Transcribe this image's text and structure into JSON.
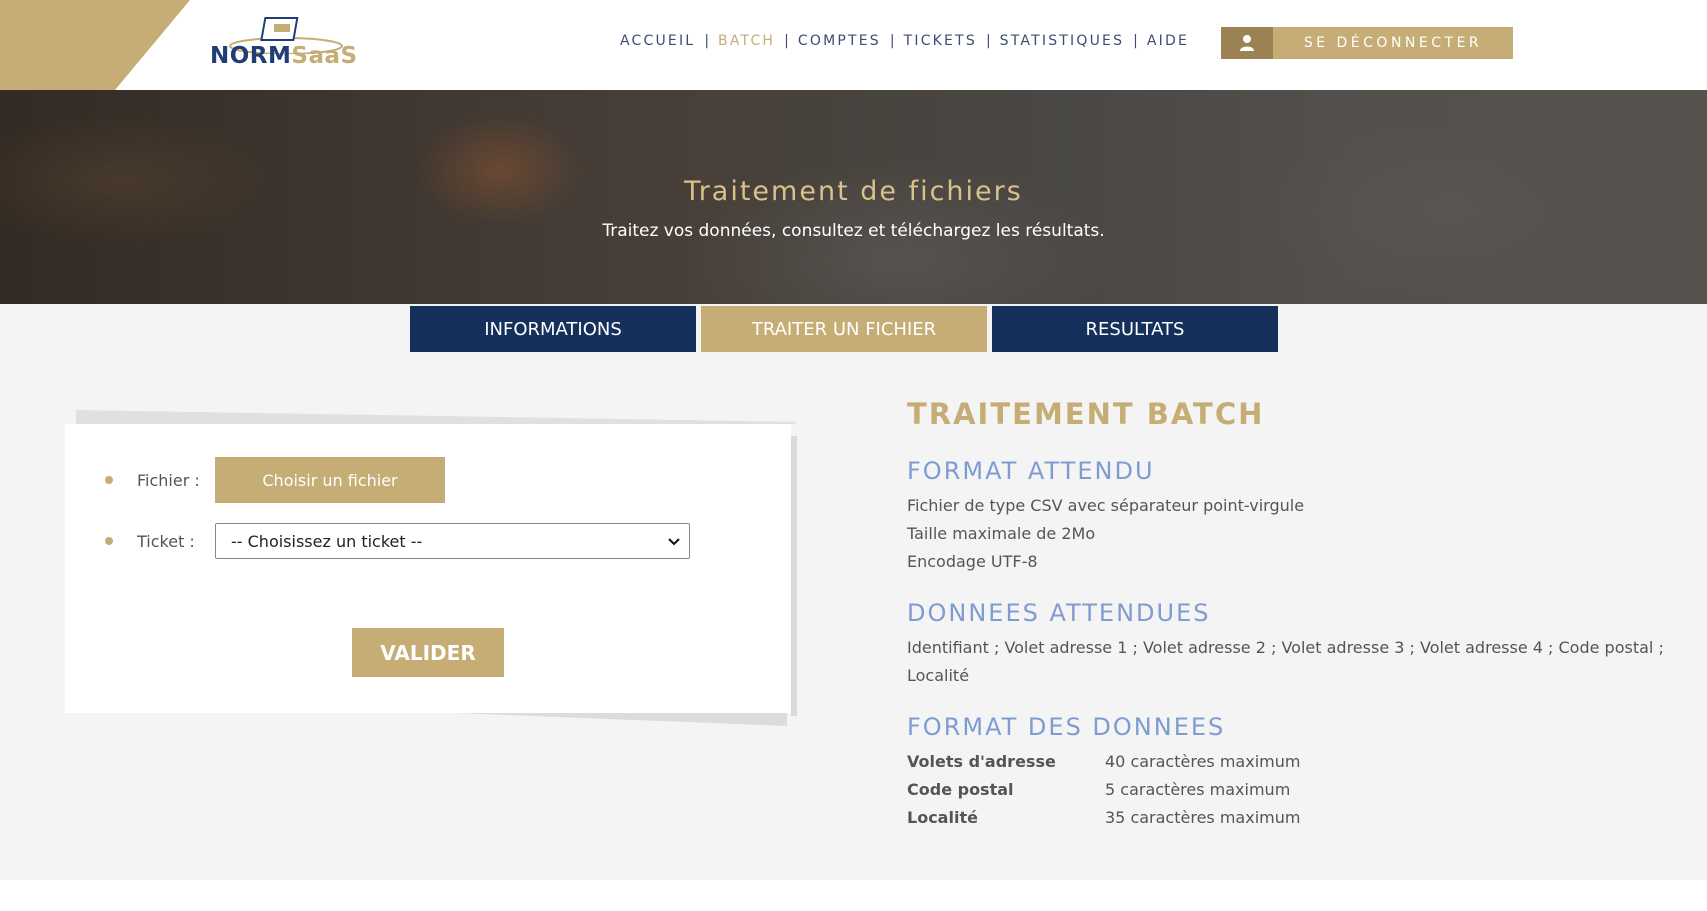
{
  "brand": {
    "logo_part1": "NORM",
    "logo_part2": "SaaS"
  },
  "nav": {
    "items": [
      "ACCUEIL",
      "BATCH",
      "COMPTES",
      "TICKETS",
      "STATISTIQUES",
      "AIDE"
    ],
    "active": "BATCH",
    "logout_label": "SE DÉCONNECTER"
  },
  "hero": {
    "title": "Traitement de fichiers",
    "subtitle": "Traitez vos données, consultez et téléchargez les résultats."
  },
  "tabs": [
    {
      "label": "INFORMATIONS",
      "active": false
    },
    {
      "label": "TRAITER UN FICHIER",
      "active": true
    },
    {
      "label": "RESULTATS",
      "active": false
    }
  ],
  "form": {
    "file_label": "Fichier :",
    "file_button": "Choisir un fichier",
    "ticket_label": "Ticket :",
    "ticket_selected": "-- Choisissez un ticket --",
    "submit": "VALIDER"
  },
  "info": {
    "title": "TRAITEMENT BATCH",
    "format_heading": "FORMAT ATTENDU",
    "format_lines": [
      "Fichier de type CSV avec séparateur point-virgule",
      "Taille maximale de 2Mo",
      "Encodage UTF-8"
    ],
    "data_heading": "DONNEES ATTENDUES",
    "data_line": "Identifiant ; Volet adresse 1 ; Volet adresse 2 ; Volet adresse 3 ; Volet adresse 4 ; Code postal ; Localité",
    "spec_heading": "FORMAT DES DONNEES",
    "specs": [
      {
        "key": "Volets d'adresse",
        "value": "40 caractères maximum"
      },
      {
        "key": "Code postal",
        "value": "5 caractères maximum"
      },
      {
        "key": "Localité",
        "value": "35 caractères maximum"
      }
    ]
  },
  "colors": {
    "gold": "#c6ad76",
    "navy": "#15305a",
    "heading_blue": "#7f9cd0"
  },
  "icons": {
    "logout": "user-icon",
    "select": "chevron-down-icon",
    "bullet": "bullet-dot"
  }
}
